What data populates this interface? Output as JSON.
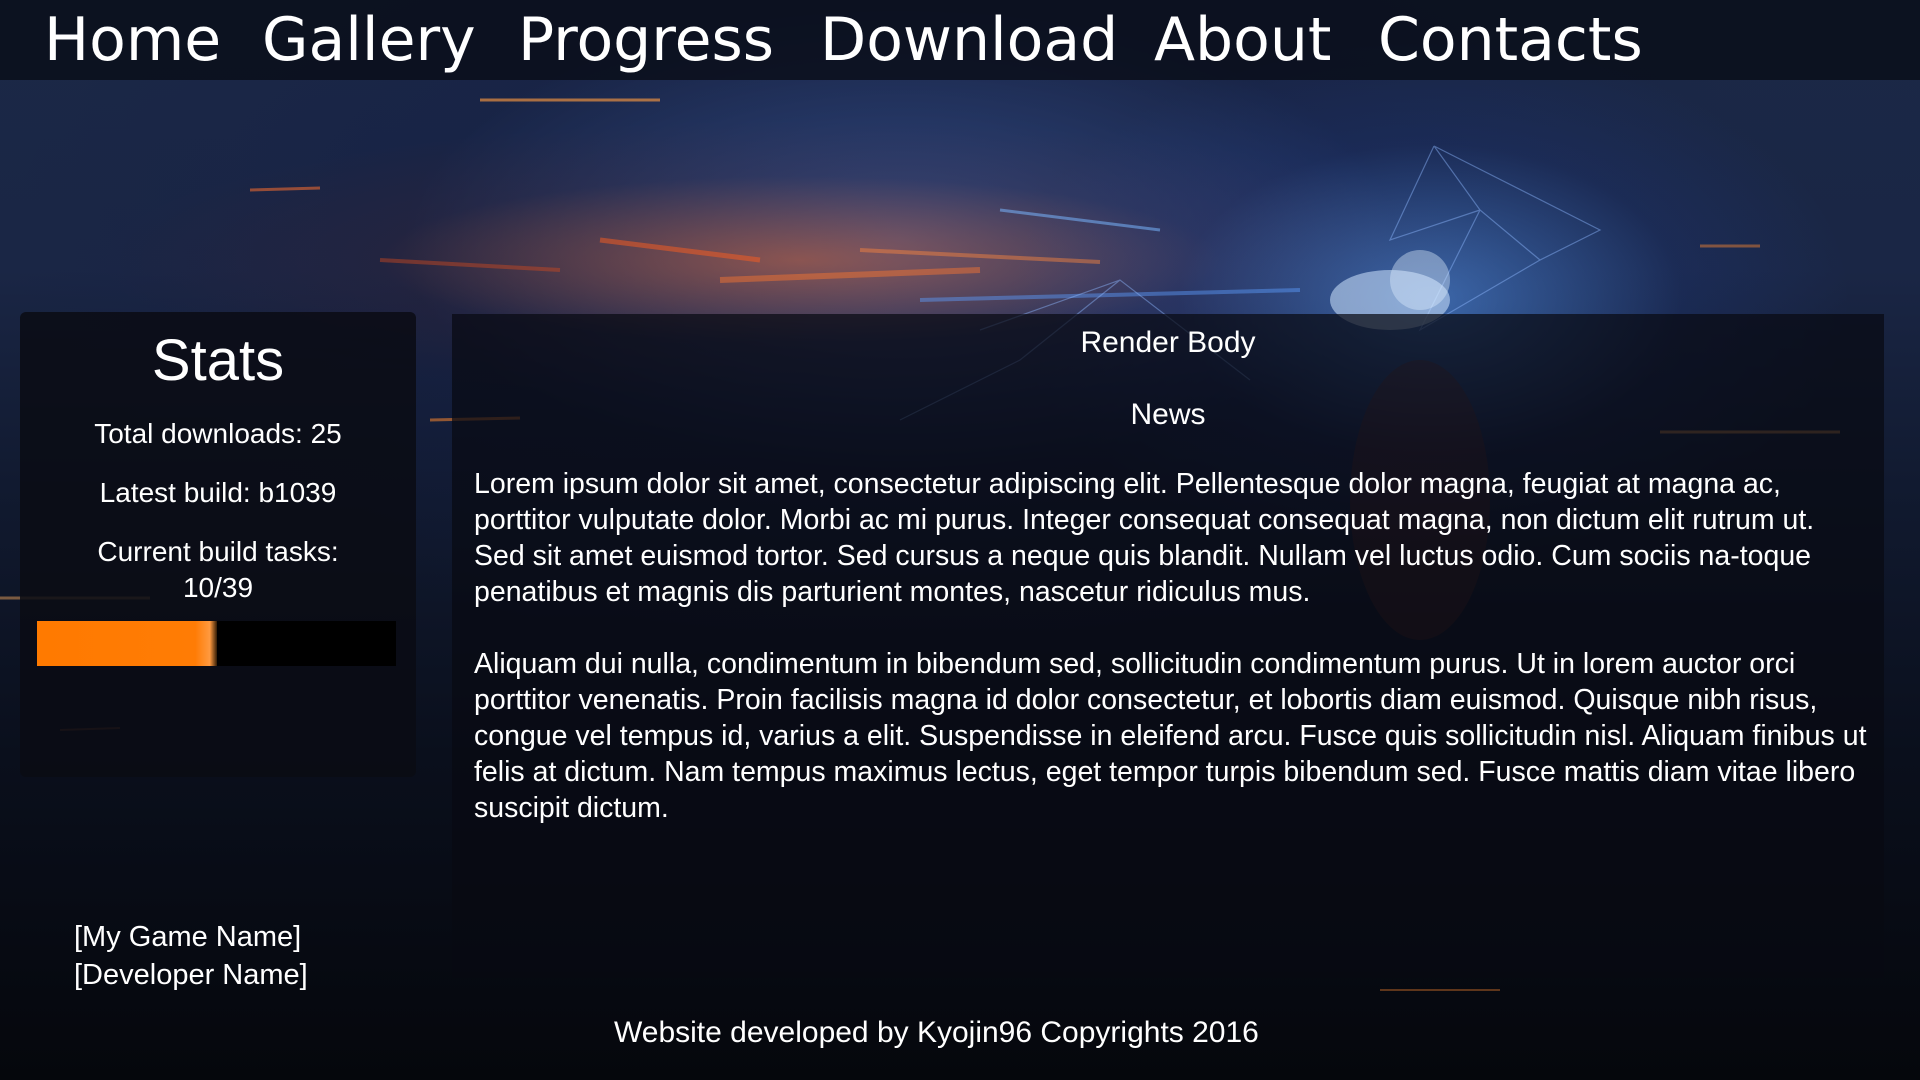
{
  "nav": {
    "items": [
      {
        "label": "Home"
      },
      {
        "label": "Gallery"
      },
      {
        "label": "Progress"
      },
      {
        "label": "Download"
      },
      {
        "label": "About"
      },
      {
        "label": "Contacts"
      }
    ]
  },
  "stats": {
    "title": "Stats",
    "total_downloads": "Total downloads: 25",
    "latest_build": "Latest build: b1039",
    "current_tasks_label": "Current build tasks:",
    "current_tasks_value": "10/39",
    "progress_fraction": 0.5,
    "progress_color": "#ff7a00"
  },
  "credits": {
    "game_name": "[My Game Name]",
    "developer_name": "[Developer Name]"
  },
  "main": {
    "render_body": "Render Body",
    "news_title": "News",
    "paragraphs": [
      "Lorem ipsum dolor sit amet, consectetur adipiscing elit. Pellentesque dolor magna, feugiat at magna ac, porttitor vulputate dolor. Morbi ac mi purus. Integer consequat consequat magna, non dictum elit rutrum ut. Sed sit amet euismod tortor. Sed cursus a neque quis blandit. Nullam vel luctus odio. Cum sociis na-toque penatibus et magnis dis parturient montes, nascetur ridiculus mus.",
      "Aliquam dui nulla, condimentum in bibendum sed, sollicitudin condimentum purus. Ut in lorem auctor orci porttitor venenatis. Proin facilisis magna id dolor consectetur, et lobortis diam euismod. Quisque nibh risus, congue vel tempus id, varius a elit. Suspendisse in eleifend arcu. Fusce quis sollicitudin nisl. Aliquam finibus ut felis at dictum. Nam tempus maximus lectus, eget tempor turpis bibendum sed. Fusce mattis diam vitae libero suscipit dictum."
    ]
  },
  "footer": {
    "text": "Website developed by Kyojin96 Copyrights 2016"
  }
}
